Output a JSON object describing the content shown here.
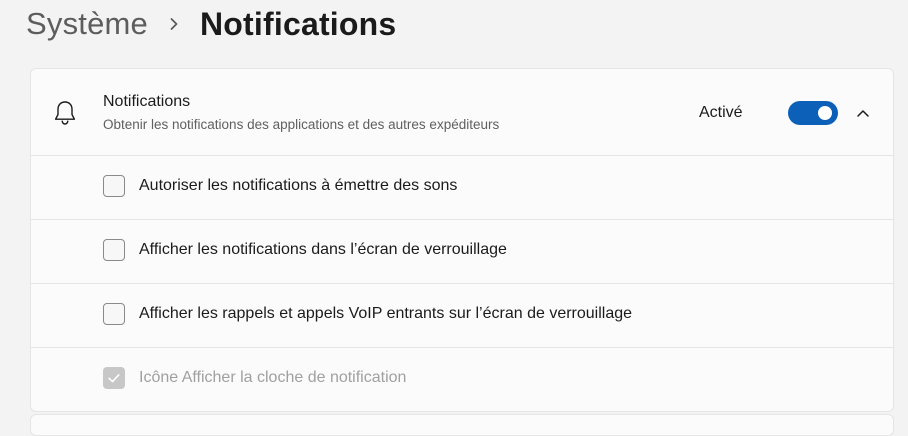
{
  "breadcrumb": {
    "parent": "Système",
    "current": "Notifications"
  },
  "notifications": {
    "title": "Notifications",
    "subtitle": "Obtenir les notifications des applications et des autres expéditeurs",
    "state_label": "Activé",
    "toggle_on": true,
    "expanded": true
  },
  "options": [
    {
      "label": "Autoriser les notifications à émettre des sons",
      "checked": false,
      "disabled": false
    },
    {
      "label": "Afficher les notifications dans l’écran de verrouillage",
      "checked": false,
      "disabled": false
    },
    {
      "label": "Afficher les rappels et appels VoIP entrants sur l’écran de verrouillage",
      "checked": false,
      "disabled": false
    },
    {
      "label": "Icône Afficher la cloche de notification",
      "checked": true,
      "disabled": true
    }
  ],
  "icons": {
    "breadcrumb_separator": "chevron-right-icon",
    "notifications": "bell-icon",
    "expand": "chevron-up-icon",
    "checkmark": "checkmark-icon"
  },
  "colors": {
    "accent": "#0c60b8",
    "background": "#f3f3f3",
    "card": "#fbfbfb",
    "disabled_check": "#c7c7c7"
  }
}
